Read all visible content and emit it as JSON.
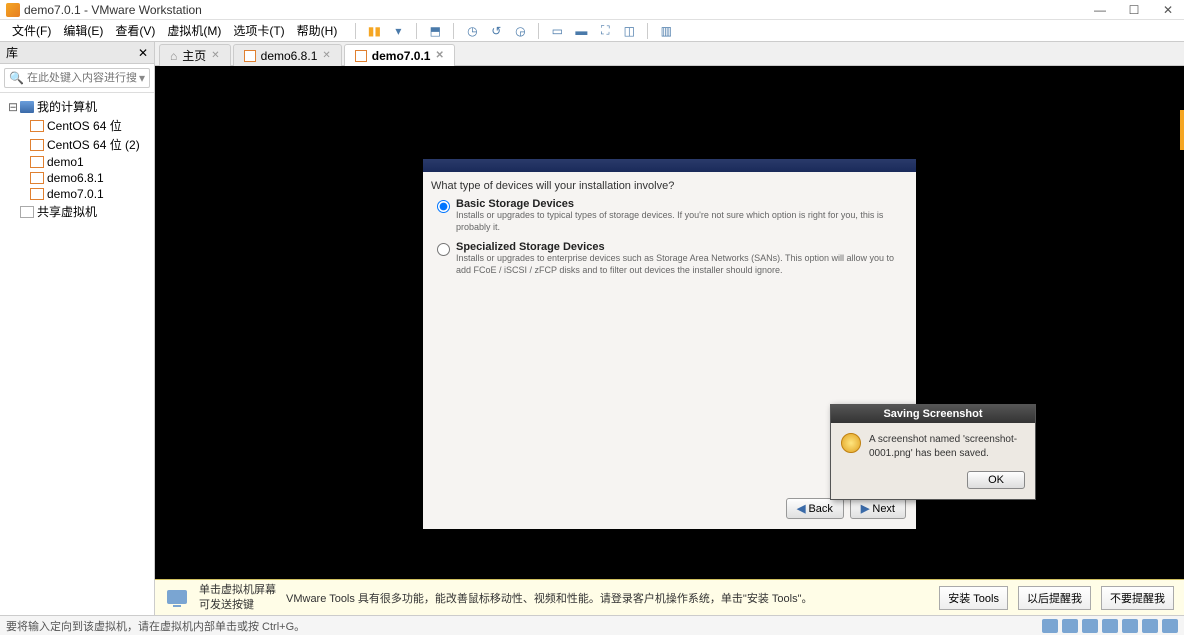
{
  "titlebar": {
    "title": "demo7.0.1 - VMware Workstation"
  },
  "menus": {
    "file": "文件(F)",
    "edit": "编辑(E)",
    "view": "查看(V)",
    "vm": "虚拟机(M)",
    "tabs": "选项卡(T)",
    "help": "帮助(H)"
  },
  "sidebar": {
    "header": "库",
    "search_placeholder": "在此处键入内容进行搜...",
    "root": "我的计算机",
    "items": [
      "CentOS 64 位",
      "CentOS 64 位 (2)",
      "demo1",
      "demo6.8.1",
      "demo7.0.1"
    ],
    "shared": "共享虚拟机"
  },
  "tabs": [
    {
      "label": "主页",
      "type": "home"
    },
    {
      "label": "demo6.8.1",
      "type": "vm"
    },
    {
      "label": "demo7.0.1",
      "type": "vm",
      "active": true
    }
  ],
  "installer": {
    "question": "What type of devices will your installation involve?",
    "opt1_title": "Basic Storage Devices",
    "opt1_desc": "Installs or upgrades to typical types of storage devices.  If you're not sure which option is right for you, this is probably it.",
    "opt2_title": "Specialized Storage Devices",
    "opt2_desc": "Installs or upgrades to enterprise devices such as Storage Area Networks (SANs). This option will allow you to add FCoE / iSCSI / zFCP disks and to filter out devices the installer should ignore.",
    "back": "Back",
    "next": "Next"
  },
  "dialog": {
    "title": "Saving Screenshot",
    "message": "A screenshot named 'screenshot-0001.png' has been saved.",
    "ok": "OK"
  },
  "infobar": {
    "hint1": "单击虚拟机屏幕",
    "hint2": "可发送按键",
    "message": "VMware Tools 具有很多功能，能改善鼠标移动性、视频和性能。请登录客户机操作系统，单击\"安装 Tools\"。",
    "btn1": "安装 Tools",
    "btn2": "以后提醒我",
    "btn3": "不要提醒我"
  },
  "statusbar": {
    "text": "要将输入定向到该虚拟机，请在虚拟机内部单击或按 Ctrl+G。"
  }
}
